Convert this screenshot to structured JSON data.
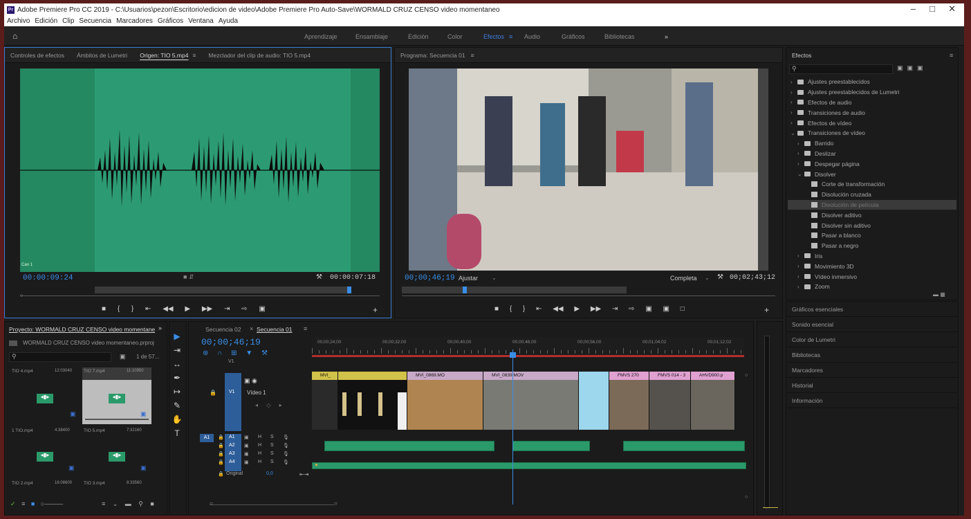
{
  "window": {
    "title": "Adobe Premiere Pro CC 2019 - C:\\Usuarios\\pezon\\Escritorio\\edicion de video\\Adobe Premiere Pro Auto-Save\\WORMALD CRUZ CENSO video momentaneo",
    "app_icon": "Pr",
    "controls": [
      "–",
      "□",
      "✕"
    ]
  },
  "menu": [
    "Archivo",
    "Edición",
    "Clip",
    "Secuencia",
    "Marcadores",
    "Gráficos",
    "Ventana",
    "Ayuda"
  ],
  "workspaces": {
    "items": [
      "Aprendizaje",
      "Ensamblaje",
      "Edición",
      "Color",
      "Efectos",
      "Audio",
      "Gráficos",
      "Bibliotecas"
    ],
    "active": "Efectos",
    "more": "»"
  },
  "source_panel": {
    "tabs": [
      "Controles de efectos",
      "Ámbitos de Lumetri",
      "Origen: TIO 5.mp4",
      "Mezclador del clip de audio: TIO 5.mp4"
    ],
    "active_tab": "Origen: TIO 5.mp4",
    "channel_label": "Can 1",
    "timecode_current": "00:00:09:24",
    "timecode_duration": "00:00:07:18",
    "waveform_color": "#2c9b73",
    "waveform_dim_color": "#248860"
  },
  "program_panel": {
    "title": "Programa: Secuencia 01",
    "timecode_current": "00;00;46;19",
    "fit": "Ajustar",
    "quality": "Completa",
    "timecode_duration": "00;02;43;12"
  },
  "effects_panel": {
    "title": "Efectos",
    "search_placeholder": "",
    "items": [
      {
        "label": "Ajustes preestablecidos",
        "level": 0,
        "kind": "folder",
        "expanded": false
      },
      {
        "label": "Ajustes preestablecidos de Lumetri",
        "level": 0,
        "kind": "folder",
        "expanded": false
      },
      {
        "label": "Efectos de audio",
        "level": 0,
        "kind": "folder",
        "expanded": false
      },
      {
        "label": "Transiciones de audio",
        "level": 0,
        "kind": "folder",
        "expanded": false
      },
      {
        "label": "Efectos de vídeo",
        "level": 0,
        "kind": "folder",
        "expanded": false
      },
      {
        "label": "Transiciones de vídeo",
        "level": 0,
        "kind": "folder",
        "expanded": true
      },
      {
        "label": "Barrido",
        "level": 1,
        "kind": "folder",
        "expanded": false
      },
      {
        "label": "Deslizar",
        "level": 1,
        "kind": "folder",
        "expanded": false
      },
      {
        "label": "Despegar página",
        "level": 1,
        "kind": "folder",
        "expanded": false
      },
      {
        "label": "Disolver",
        "level": 1,
        "kind": "folder",
        "expanded": true
      },
      {
        "label": "Corte de transformación",
        "level": 2,
        "kind": "preset"
      },
      {
        "label": "Disolución cruzada",
        "level": 2,
        "kind": "preset"
      },
      {
        "label": "Disolución de película",
        "level": 2,
        "kind": "preset",
        "selected": true
      },
      {
        "label": "Disolver aditivo",
        "level": 2,
        "kind": "preset"
      },
      {
        "label": "Disolver sin aditivo",
        "level": 2,
        "kind": "preset"
      },
      {
        "label": "Pasar a blanco",
        "level": 2,
        "kind": "preset"
      },
      {
        "label": "Pasar a negro",
        "level": 2,
        "kind": "preset"
      },
      {
        "label": "Iris",
        "level": 1,
        "kind": "folder",
        "expanded": false
      },
      {
        "label": "Movimiento 3D",
        "level": 1,
        "kind": "folder",
        "expanded": false
      },
      {
        "label": "Vídeo inmersivo",
        "level": 1,
        "kind": "folder",
        "expanded": false
      },
      {
        "label": "Zoom",
        "level": 1,
        "kind": "folder",
        "expanded": false
      }
    ]
  },
  "side_panels": [
    "Gráficos esenciales",
    "Sonido esencial",
    "Color de Lumetri",
    "Bibliotecas",
    "Marcadores",
    "Historial",
    "Información"
  ],
  "project_panel": {
    "title": "Proyecto: WORMALD CRUZ CENSO video momentane",
    "more": "»",
    "file": "WORMALD CRUZ CENSO video momentaneo.prproj",
    "count": "1 de 57...",
    "items": [
      {
        "name": "TIO 4.mp4",
        "duration": "12:03040",
        "selected": false
      },
      {
        "name": "TIO 7.mp4",
        "duration": "11:10950",
        "selected": false
      },
      {
        "name": "1 TIO.mp4",
        "duration": "4:38400",
        "selected": false
      },
      {
        "name": "TIO 5.mp4",
        "duration": "7:32160",
        "selected": true
      },
      {
        "name": "TIO 2.mp4",
        "duration": "16:08600",
        "selected": false
      },
      {
        "name": "TIO 3.mp4",
        "duration": "8:33560",
        "selected": false
      }
    ]
  },
  "tools": [
    "▶",
    "⇥",
    "↔",
    "✒",
    "↦",
    "✎",
    "✋",
    "T"
  ],
  "timeline": {
    "tabs": [
      "Secuencia 02",
      "Secuencia 01"
    ],
    "active_tab": "Secuencia 01",
    "timecode": "00;00;46;19",
    "ruler": [
      "00;00;24;00",
      "00;00;32;00",
      "00;00;40;00",
      "00;00;48;00",
      "00;00;56;00",
      "00;01;04;02",
      "00;01;12;02"
    ],
    "video_tracks": [
      {
        "id": "V1",
        "name": "Vídeo 1"
      }
    ],
    "audio_tracks": [
      "A1",
      "A2",
      "A3",
      "A4"
    ],
    "source_patch": "A1",
    "master": {
      "label": "Original",
      "value": "0,0"
    },
    "clips": [
      "MVI_",
      "MVI_0869.MO",
      "MVI_0839.MOV",
      "FMVS 270",
      "FMVS 014 - 3",
      "AHVD900.p"
    ],
    "track_controls": {
      "mute": "M",
      "solo": "S",
      "sync": "H"
    }
  }
}
